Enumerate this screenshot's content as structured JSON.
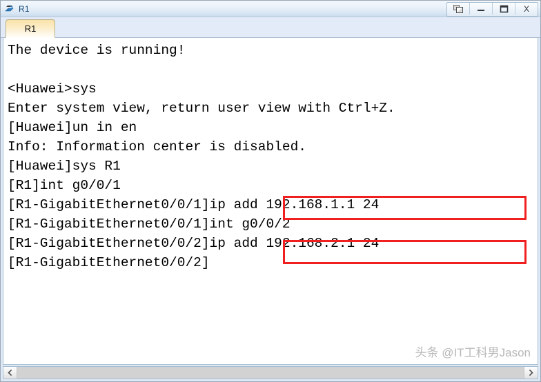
{
  "window": {
    "title": "R1",
    "icon": "router-icon",
    "buttons": [
      {
        "name": "restore-button",
        "label": "❐",
        "icon": "restore-icon"
      },
      {
        "name": "minimize-button",
        "label": "–",
        "icon": "minimize-icon"
      },
      {
        "name": "maximize-button",
        "label": "☐",
        "icon": "maximize-icon"
      },
      {
        "name": "close-button",
        "label": "X",
        "icon": "close-icon"
      }
    ]
  },
  "tabs": [
    {
      "label": "R1",
      "active": true
    }
  ],
  "console": {
    "lines": [
      "The device is running!",
      "",
      "<Huawei>sys",
      "Enter system view, return user view with Ctrl+Z.",
      "[Huawei]un in en",
      "Info: Information center is disabled.",
      "[Huawei]sys R1",
      "[R1]int g0/0/1",
      "[R1-GigabitEthernet0/0/1]ip add 192.168.1.1 24",
      "[R1-GigabitEthernet0/0/1]int g0/0/2",
      "[R1-GigabitEthernet0/0/2]ip add 192.168.2.1 24",
      "[R1-GigabitEthernet0/0/2]"
    ],
    "highlights": [
      {
        "name": "highlight-ip-add-1",
        "text": "ip add 192.168.1.1 24",
        "color": "#f02020"
      },
      {
        "name": "highlight-ip-add-2",
        "text": "ip add 192.168.2.1 24",
        "color": "#f02020"
      }
    ],
    "watermark": "头条 @IT工科男Jason"
  },
  "scrollbar": {
    "left_arrow": "‹",
    "right_arrow": "›"
  },
  "colors": {
    "highlight": "#f02020",
    "title_text": "#1b4a7a",
    "tab_accent": "#f9e3ab"
  }
}
